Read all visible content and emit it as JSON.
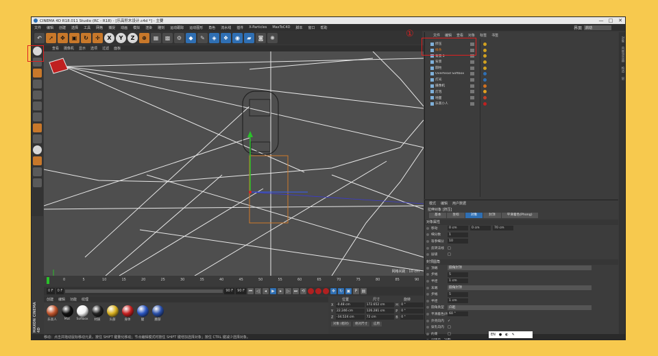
{
  "window": {
    "title": "CINEMA 4D R18.011 Studio (RC - R18) - [乐高积木设计.c4d *] - 主要",
    "controls": [
      "—",
      "□",
      "✕"
    ]
  },
  "menubar": [
    "文件",
    "编辑",
    "创建",
    "选择",
    "工具",
    "网格",
    "捕捉",
    "动画",
    "模拟",
    "渲染",
    "雕刻",
    "运动跟踪",
    "运动图形",
    "角色",
    "流水线",
    "插件",
    "X-Particles",
    "MaxToC4D",
    "脚本",
    "窗口",
    "帮助"
  ],
  "layout": {
    "label": "界面",
    "value": "启动"
  },
  "toolbar": {
    "buttons": [
      "undo-icon",
      "select-arrow-icon",
      "move-icon",
      "scale-icon",
      "rotate-icon",
      "live-select-icon",
      "x-axis-icon",
      "y-axis-icon",
      "z-axis-icon",
      "world-coord-icon",
      "render-view-icon",
      "render-picture-icon",
      "render-settings-icon",
      "cube-icon",
      "pen-icon",
      "subdivision-icon",
      "array-icon",
      "deformer-icon",
      "floor-icon",
      "camera-icon",
      "light-icon"
    ],
    "axis_labels": [
      "X",
      "Y",
      "Z"
    ]
  },
  "viewport": {
    "menu": [
      "查看",
      "摄像机",
      "显示",
      "选项",
      "过滤",
      "面板"
    ],
    "grid_label": "网格间距 : 10 cm"
  },
  "timeline": {
    "ticks": [
      "0",
      "5",
      "10",
      "15",
      "20",
      "25",
      "30",
      "35",
      "40",
      "45",
      "50",
      "55",
      "60",
      "65",
      "70",
      "75",
      "80",
      "85",
      "90"
    ],
    "frame_field": "0 F",
    "start": "0 F",
    "end": "90 F",
    "end2": "90 F",
    "current": "0 F"
  },
  "materials": {
    "menu": [
      "创建",
      "编辑",
      "功能",
      "纹理"
    ],
    "items": [
      {
        "name": "乐高人",
        "color": "#c0552d"
      },
      {
        "name": "Mat",
        "color": "#111111"
      },
      {
        "name": "Softbox",
        "color": "#f2f2f2"
      },
      {
        "name": "材质",
        "color": "#222222"
      },
      {
        "name": "头部",
        "color": "#d8b020"
      },
      {
        "name": "身体",
        "color": "#c52020"
      },
      {
        "name": "腿",
        "color": "#2a55c0"
      },
      {
        "name": "腰部",
        "color": "#2a4fa8"
      }
    ]
  },
  "coords": {
    "headers": [
      "位置",
      "尺寸",
      "旋转"
    ],
    "rows": [
      {
        "axis": "X",
        "pos": "-0.48 cm",
        "size": "172.652 cm",
        "rot_label": "H",
        "rot": "0 °"
      },
      {
        "axis": "Y",
        "pos": "22.246 cm",
        "size": "126.281 cm",
        "rot_label": "P",
        "rot": "0 °"
      },
      {
        "axis": "Z",
        "pos": "-34.524 cm",
        "size": "72 cm",
        "rot_label": "B",
        "rot": "0 °"
      }
    ],
    "mode1": "对象 (相对)",
    "mode2": "绝对尺寸",
    "apply": "应用"
  },
  "status": "移动：点击并拖动鼠标移动元素。按住 SHIFT 键量化移动；节点编辑模式时按住 SHIFT 键增加选择对象；按住 CTRL 键减少选择对象。",
  "maxon": "MAXON CINEMA 4D",
  "objects": {
    "menu": [
      "文件",
      "编辑",
      "查看",
      "对象",
      "标签",
      "书签"
    ],
    "items": [
      {
        "name": "挤压",
        "highlight": false,
        "tag": "#d0a020"
      },
      {
        "name": "样条",
        "highlight": true,
        "tag": "#d0a020"
      },
      {
        "name": "背景 2",
        "highlight": false,
        "tag": "#d0a020"
      },
      {
        "name": "背景",
        "highlight": false,
        "tag": "#d0a020"
      },
      {
        "name": "圆柱",
        "highlight": false,
        "tag": "#d0a020"
      },
      {
        "name": "Overhead Softbox",
        "highlight": false,
        "tag": "#2f6fb3"
      },
      {
        "name": "灯光",
        "highlight": false,
        "tag": "#2f6fb3"
      },
      {
        "name": "摄像机",
        "highlight": false,
        "tag": "#d07020"
      },
      {
        "name": "灯泡",
        "highlight": false,
        "tag": "#e0a020"
      },
      {
        "name": "地面",
        "highlight": false,
        "tag": "#c0402a"
      },
      {
        "name": "乐高小人",
        "highlight": false,
        "tag": "#c02020"
      }
    ]
  },
  "annotation": "①",
  "attributes": {
    "menu": [
      "模式",
      "编辑",
      "用户数据"
    ],
    "title": "拉伸对象 [挤压]",
    "tabs": [
      "基本",
      "坐标",
      "对象",
      "封顶",
      "平滑着色(Phong)"
    ],
    "active_tab": "对象",
    "section1": "对象属性",
    "props1": [
      {
        "label": "移动",
        "values": [
          "0 cm",
          "0 cm",
          "70 cm"
        ]
      },
      {
        "label": "细分数",
        "values": [
          "1"
        ]
      },
      {
        "label": "等参细分",
        "values": [
          "10"
        ]
      },
      {
        "label": "反转法线",
        "values": [
          "□"
        ]
      },
      {
        "label": "层级",
        "values": [
          "□"
        ]
      }
    ],
    "section2": "封顶圆角",
    "props2": [
      {
        "label": "顶端",
        "dropdown": "圆角封顶"
      },
      {
        "label": "步幅",
        "values": [
          "5"
        ]
      },
      {
        "label": "半径",
        "values": [
          "1 cm"
        ]
      },
      {
        "label": "末端",
        "dropdown": "圆角封顶"
      },
      {
        "label": "步幅",
        "values": [
          "5"
        ]
      },
      {
        "label": "半径",
        "values": [
          "1 cm"
        ]
      }
    ],
    "props3": [
      {
        "label": "圆角类型",
        "dropdown": "凸起"
      },
      {
        "label": "平滑着色(Phong)角度",
        "values": [
          "60 °"
        ]
      },
      {
        "label": "外壳向内",
        "values": [
          "✓"
        ]
      },
      {
        "label": "穿孔向内",
        "values": [
          "□"
        ]
      },
      {
        "label": "约束",
        "values": [
          "□"
        ]
      },
      {
        "label": "创建单一对象",
        "values": [
          "□"
        ]
      }
    ]
  },
  "side_tabs": [
    "对象",
    "内容浏览器",
    "构造",
    "层"
  ],
  "langbar": {
    "text": "EN"
  }
}
